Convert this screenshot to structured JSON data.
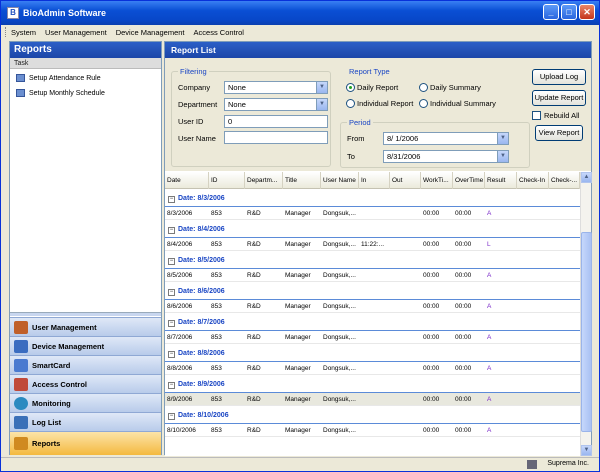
{
  "window": {
    "title": "BioAdmin Software"
  },
  "menu": [
    "System",
    "User Management",
    "Device Management",
    "Access Control"
  ],
  "left_panel": {
    "header": "Reports",
    "task_label": "Task",
    "tasks": [
      "Setup Attendance Rule",
      "Setup Monthly Schedule"
    ],
    "nav": [
      {
        "label": "User Management",
        "color": "#c0602a"
      },
      {
        "label": "Device Management",
        "color": "#3a6cc0"
      },
      {
        "label": "SmartCard",
        "color": "#4a7ad0"
      },
      {
        "label": "Access Control",
        "color": "#c04a3a"
      },
      {
        "label": "Monitoring",
        "color": "#2a8ac0"
      },
      {
        "label": "Log List",
        "color": "#3a70b8"
      },
      {
        "label": "Reports",
        "color": "#d08a20"
      }
    ]
  },
  "report_list": {
    "header": "Report List",
    "filtering": {
      "label": "Filtering",
      "company_label": "Company",
      "company_value": "None",
      "department_label": "Department",
      "department_value": "None",
      "userid_label": "User ID",
      "userid_value": "0",
      "username_label": "User Name",
      "username_value": ""
    },
    "report_type": {
      "label": "Report Type",
      "options": [
        "Daily Report",
        "Daily Summary",
        "Individual Report",
        "Individual Summary"
      ],
      "selected": "Daily Report"
    },
    "period": {
      "label": "Period",
      "from_label": "From",
      "from_value": "8/ 1/2006",
      "to_label": "To",
      "to_value": "8/31/2006"
    },
    "buttons": {
      "upload_log": "Upload Log",
      "update_report": "Update Report",
      "rebuild_all": "Rebuild All",
      "view_report": "View Report"
    },
    "columns": [
      "Date",
      "ID",
      "Departm...",
      "Title",
      "User Name",
      "In",
      "Out",
      "WorkTi...",
      "OverTime",
      "Result",
      "Check-In",
      "Check-..."
    ],
    "groups": [
      {
        "label": "Date: 8/3/2006",
        "row": [
          "8/3/2006",
          "853",
          "R&D",
          "Manager",
          "Dongsuk,...",
          "",
          "",
          "00:00",
          "00:00",
          "A"
        ]
      },
      {
        "label": "Date: 8/4/2006",
        "row": [
          "8/4/2006",
          "853",
          "R&D",
          "Manager",
          "Dongsuk,...",
          "11:22:...",
          "",
          "00:00",
          "00:00",
          "L"
        ]
      },
      {
        "label": "Date: 8/5/2006",
        "row": [
          "8/5/2006",
          "853",
          "R&D",
          "Manager",
          "Dongsuk,...",
          "",
          "",
          "00:00",
          "00:00",
          "A"
        ]
      },
      {
        "label": "Date: 8/6/2006",
        "row": [
          "8/6/2006",
          "853",
          "R&D",
          "Manager",
          "Dongsuk,...",
          "",
          "",
          "00:00",
          "00:00",
          "A"
        ]
      },
      {
        "label": "Date: 8/7/2006",
        "row": [
          "8/7/2006",
          "853",
          "R&D",
          "Manager",
          "Dongsuk,...",
          "",
          "",
          "00:00",
          "00:00",
          "A"
        ]
      },
      {
        "label": "Date: 8/8/2006",
        "row": [
          "8/8/2006",
          "853",
          "R&D",
          "Manager",
          "Dongsuk,...",
          "",
          "",
          "00:00",
          "00:00",
          "A"
        ]
      },
      {
        "label": "Date: 8/9/2006",
        "row": [
          "8/9/2006",
          "853",
          "R&D",
          "Manager",
          "Dongsuk,...",
          "",
          "",
          "00:00",
          "00:00",
          "A"
        ]
      },
      {
        "label": "Date: 8/10/2006",
        "row": [
          "8/10/2006",
          "853",
          "R&D",
          "Manager",
          "Dongsuk,...",
          "",
          "",
          "00:00",
          "00:00",
          "A"
        ]
      }
    ]
  },
  "status": {
    "company": "Suprema Inc."
  }
}
